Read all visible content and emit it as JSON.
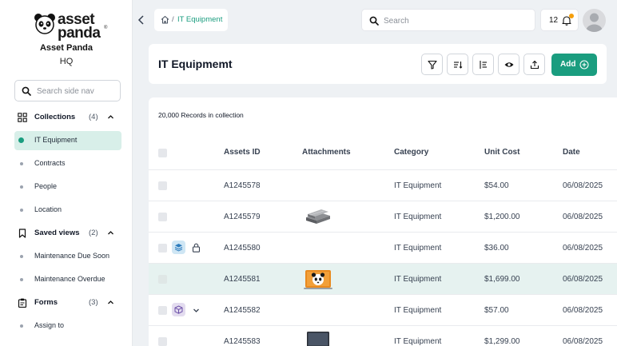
{
  "brand": {
    "logo_top": "asset",
    "logo_bottom": "panda",
    "reg": "®",
    "org_name": "Asset Panda",
    "org_sub": "HQ",
    "accent": "#1a9d7f"
  },
  "sidebar": {
    "search_placeholder": "Search side nav",
    "collections": {
      "label": "Collections",
      "count": "(4)",
      "icon": "grid-icon"
    },
    "collection_items": [
      "IT Equipment",
      "Contracts",
      "People",
      "Location"
    ],
    "saved_views": {
      "label": "Saved views",
      "count": "(2)",
      "icon": "bookmark-icon"
    },
    "saved_items": [
      "Maintenance Due Soon",
      "Maintenance Overdue"
    ],
    "forms": {
      "label": "Forms",
      "count": "(3)",
      "icon": "clipboard-icon"
    },
    "form_items": [
      "Assign to"
    ]
  },
  "topbar": {
    "breadcrumb_sep": "/",
    "breadcrumb_current": "IT Equipment",
    "search_placeholder": "Search",
    "notif_count": "12"
  },
  "header": {
    "title": "IT Equipmemt",
    "tools": [
      "filter-icon",
      "sort-icon",
      "columns-icon",
      "eye-icon",
      "export-icon"
    ],
    "add_label": "Add"
  },
  "table": {
    "records_text": "20,000 Records in collection",
    "columns": [
      "Assets ID",
      "Attachments",
      "Category",
      "Unit Cost",
      "Date"
    ],
    "rows": [
      {
        "id": "A1245578",
        "attachment": "",
        "category": "IT Equipment",
        "cost": "$54.00",
        "date": "06/08/2025"
      },
      {
        "id": "A1245579",
        "attachment": "router-image",
        "category": "IT Equipment",
        "cost": "$1,200.00",
        "date": "06/08/2025"
      },
      {
        "id": "A1245580",
        "attachment": "",
        "category": "IT Equipment",
        "cost": "$36.00",
        "date": "06/08/2025"
      },
      {
        "id": "A1245581",
        "attachment": "laptop-panda-image",
        "category": "IT Equipment",
        "cost": "$1,699.00",
        "date": "06/08/2025"
      },
      {
        "id": "A1245582",
        "attachment": "",
        "category": "IT Equipment",
        "cost": "$57.00",
        "date": "06/08/2025"
      },
      {
        "id": "A1245583",
        "attachment": "laptop-image",
        "category": "IT Equipment",
        "cost": "$1,299.00",
        "date": "06/08/2025"
      }
    ]
  }
}
